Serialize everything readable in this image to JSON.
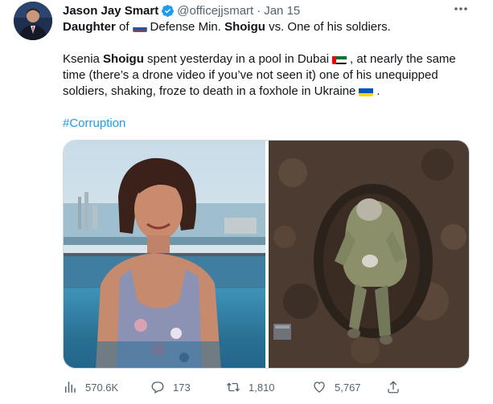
{
  "author": {
    "display_name": "Jason Jay Smart",
    "handle": "@officejjsmart",
    "separator": "·",
    "time": "Jan 15",
    "verified": true
  },
  "tweet": {
    "line1": {
      "w1": "Daughter",
      "w2": "of",
      "w3": "Defense Min.",
      "w4": "Shoigu",
      "w5": "vs. One of his soldiers."
    },
    "para": {
      "r1a": "Ksenia",
      "r1b": "Shoigu",
      "r1c": "spent yesterday in a pool in Dubai",
      "r1d": ", at nearly the same",
      "r2": "time (there’s a drone video if you’ve not seen it) one of his unequipped",
      "r3": "soldiers, shaking, froze to death in a foxhole in Ukraine",
      "r3end": "."
    },
    "hashtag": "#Corruption"
  },
  "flags": {
    "russia": "russia-flag-icon",
    "uae": "uae-flag-icon",
    "ukraine": "ukraine-flag-icon"
  },
  "stats": {
    "views": "570.6K",
    "replies": "173",
    "retweets": "1,810",
    "likes": "5,767"
  },
  "colors": {
    "link": "#1d9bf0",
    "verified": "#1d9bf0",
    "secondary_text": "#536471"
  }
}
